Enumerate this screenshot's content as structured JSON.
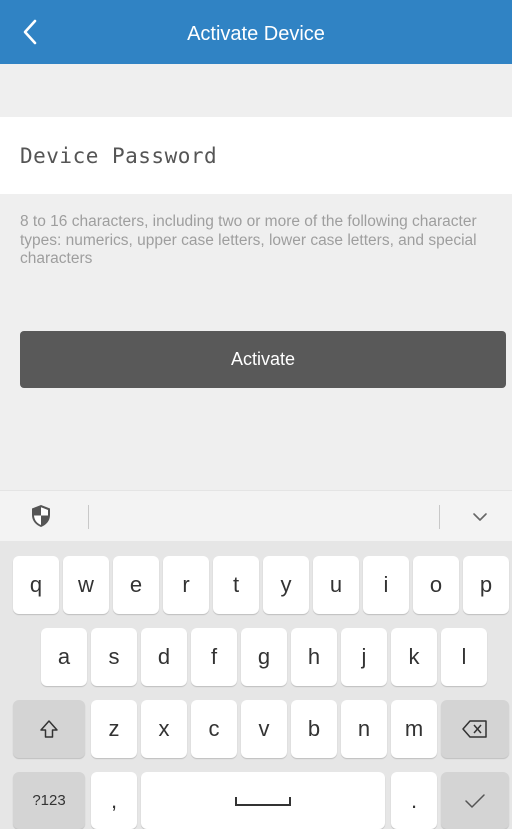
{
  "app_bar": {
    "title": "Activate Device",
    "background": "#3083c4"
  },
  "password": {
    "placeholder": "Device Password",
    "value": ""
  },
  "hint": "8 to 16 characters, including two or more of the following character types: numerics, upper case letters, lower case letters, and special characters",
  "activate_button": {
    "label": "Activate"
  },
  "keyboard": {
    "row1": [
      "q",
      "w",
      "e",
      "r",
      "t",
      "y",
      "u",
      "i",
      "o",
      "p"
    ],
    "row2": [
      "a",
      "s",
      "d",
      "f",
      "g",
      "h",
      "j",
      "k",
      "l"
    ],
    "row3": [
      "z",
      "x",
      "c",
      "v",
      "b",
      "n",
      "m"
    ],
    "symbols_label": "?123",
    "comma": ",",
    "period": "."
  },
  "colors": {
    "accent": "#3083c4",
    "button": "#595959",
    "hint_text": "#9e9e9e"
  }
}
